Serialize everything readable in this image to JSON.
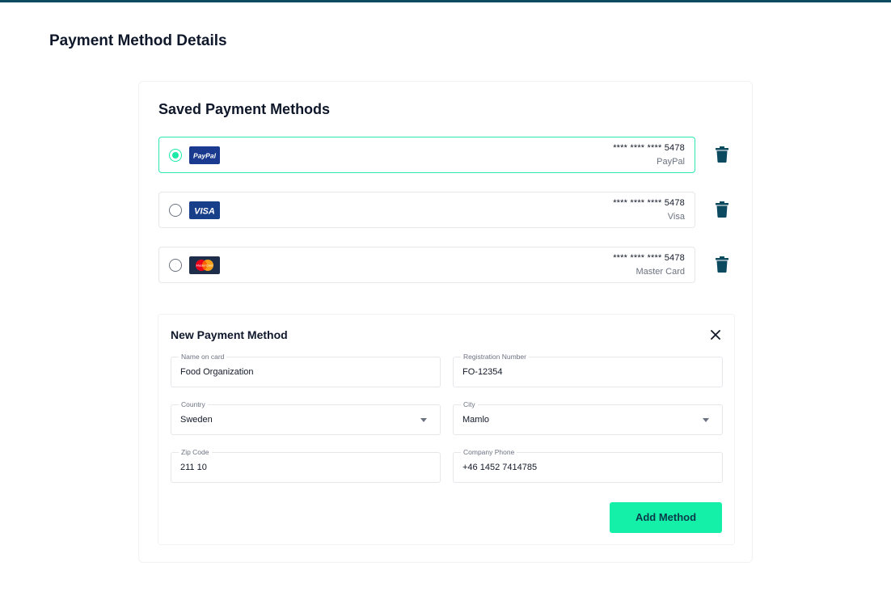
{
  "page": {
    "title": "Payment Method Details"
  },
  "saved": {
    "title": "Saved Payment Methods",
    "methods": [
      {
        "logo_text": "PayPal",
        "number": "**** **** **** 5478",
        "brand": "PayPal",
        "selected": true,
        "logo_icon": "paypal-logo"
      },
      {
        "logo_text": "VISA",
        "number": "**** **** **** 5478",
        "brand": "Visa",
        "selected": false,
        "logo_icon": "visa-logo"
      },
      {
        "logo_text": "MasterCard",
        "number": "**** **** **** 5478",
        "brand": "Master Card",
        "selected": false,
        "logo_icon": "mastercard-logo"
      }
    ]
  },
  "new_method": {
    "title": "New Payment Method",
    "fields": {
      "name_on_card": {
        "label": "Name on card",
        "value": "Food Organization"
      },
      "registration_number": {
        "label": "Registration Number",
        "value": "FO-12354"
      },
      "country": {
        "label": "Country",
        "value": "Sweden"
      },
      "city": {
        "label": "City",
        "value": "Mamlo"
      },
      "zip_code": {
        "label": "Zip Code",
        "value": "211 10"
      },
      "company_phone": {
        "label": "Company Phone",
        "value": "+46 1452 7414785"
      }
    },
    "submit_label": "Add Method"
  },
  "colors": {
    "accent": "#14f0a8",
    "selected_border": "#2ee6b0",
    "top_bar": "#0c4a60",
    "trash": "#0c4a60"
  },
  "icons": {
    "delete": "trash-icon",
    "close": "close-icon",
    "dropdown": "caret-down-icon"
  }
}
